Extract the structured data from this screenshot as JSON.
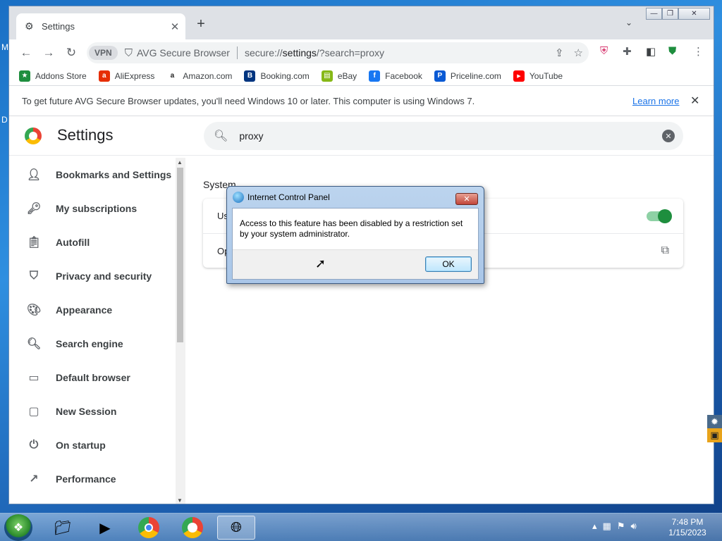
{
  "desktop": {
    "edge_letters": [
      "M",
      "D"
    ]
  },
  "browser": {
    "tab": {
      "title": "Settings",
      "icon": "gear-icon",
      "close": "✕"
    },
    "new_tab": "+",
    "window_controls": {
      "minimize": "—",
      "maximize": "❐",
      "close": "✕"
    },
    "omnibox": {
      "vpn_label": "VPN",
      "brand": "AVG Secure Browser",
      "url_scheme": "secure://",
      "url_host": "settings",
      "url_path": "/?search=proxy"
    },
    "bookmarks": [
      {
        "label": "Addons Store",
        "icon": "addons-store-icon",
        "color": "#1e8e3e",
        "glyph": "★"
      },
      {
        "label": "AliExpress",
        "icon": "aliexpress-icon",
        "color": "#e62e04",
        "glyph": "a"
      },
      {
        "label": "Amazon.com",
        "icon": "amazon-icon",
        "color": "#222222",
        "glyph": "a"
      },
      {
        "label": "Booking.com",
        "icon": "booking-icon",
        "color": "#003580",
        "glyph": "B"
      },
      {
        "label": "eBay",
        "icon": "ebay-icon",
        "color": "#86b817",
        "glyph": "▤"
      },
      {
        "label": "Facebook",
        "icon": "facebook-icon",
        "color": "#1877f2",
        "glyph": "f"
      },
      {
        "label": "Priceline.com",
        "icon": "priceline-icon",
        "color": "#0a5ad4",
        "glyph": "P"
      },
      {
        "label": "YouTube",
        "icon": "youtube-icon",
        "color": "#ff0000",
        "glyph": "▶"
      }
    ],
    "infobar": {
      "message": "To get future AVG Secure Browser updates, you'll need Windows 10 or later. This computer is using Windows 7.",
      "link": "Learn more",
      "close": "✕"
    }
  },
  "settings": {
    "title": "Settings",
    "search_value": "proxy",
    "nav": [
      {
        "label": "Bookmarks and Settings",
        "icon": "person-icon",
        "glyph": "👤"
      },
      {
        "label": "My subscriptions",
        "icon": "key-icon",
        "glyph": "🔑"
      },
      {
        "label": "Autofill",
        "icon": "clipboard-icon",
        "glyph": "📋"
      },
      {
        "label": "Privacy and security",
        "icon": "shield-icon",
        "glyph": "🛡"
      },
      {
        "label": "Appearance",
        "icon": "palette-icon",
        "glyph": "🎨"
      },
      {
        "label": "Search engine",
        "icon": "search-icon",
        "glyph": "🔍"
      },
      {
        "label": "Default browser",
        "icon": "browser-window-icon",
        "glyph": "▭"
      },
      {
        "label": "New Session",
        "icon": "window-icon",
        "glyph": "▢"
      },
      {
        "label": "On startup",
        "icon": "power-icon",
        "glyph": "⏻"
      },
      {
        "label": "Performance",
        "icon": "trending-icon",
        "glyph": "↗"
      }
    ],
    "section_title": "System",
    "row1_label": "Us",
    "row2_label": "Op"
  },
  "dialog": {
    "title": "Internet Control Panel",
    "message": "Access to this feature has been disabled by a restriction set by your system administrator.",
    "ok_label": "OK",
    "close": "✕"
  },
  "taskbar": {
    "time": "7:48 PM",
    "date": "1/15/2023"
  }
}
